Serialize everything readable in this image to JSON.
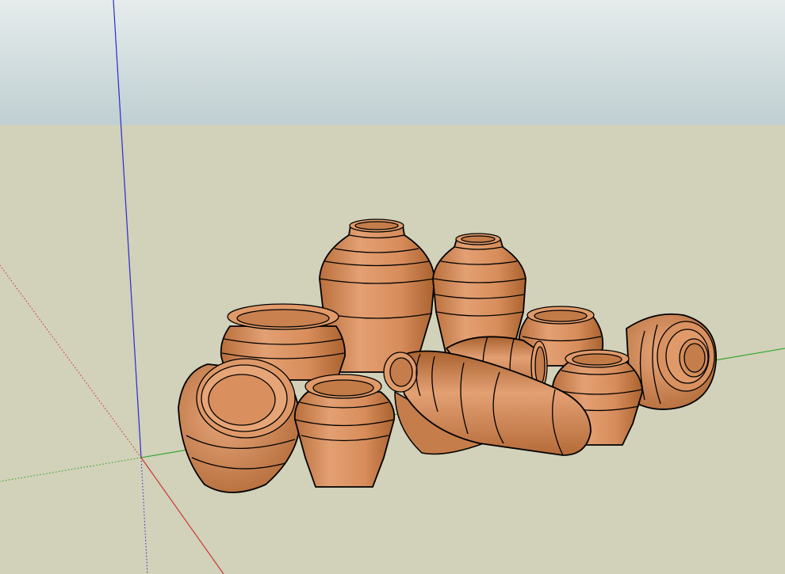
{
  "viewport": {
    "sky_top_color": "#e6ecec",
    "sky_bottom_color": "#bfcfd2",
    "ground_color": "#d2d1b9",
    "pottery_color": "#de9868",
    "edge_color": "#000000",
    "axis_colors": {
      "red": "#cc2b2b",
      "green": "#1fa31f",
      "blue": "#2a2ad0"
    }
  },
  "model": {
    "object": "pottery-group",
    "pot_count": 10,
    "components": [
      "tall-vase-center-back",
      "medium-vase-back",
      "wide-bowl-left",
      "small-pot-right",
      "lying-jar-right",
      "medium-pot-right-front",
      "pot-on-side-left",
      "pot-front-center",
      "lying-bottle-back",
      "lying-bottle-front"
    ]
  }
}
